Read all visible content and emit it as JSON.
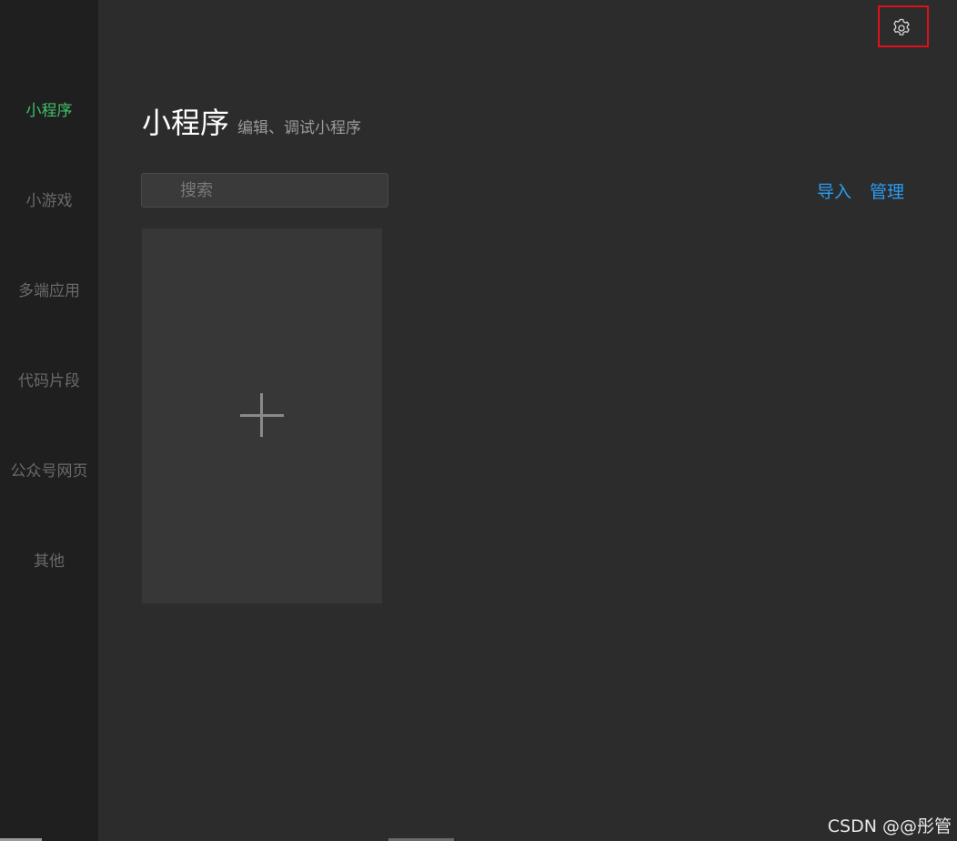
{
  "sidebar": {
    "items": [
      {
        "label": "小程序",
        "active": true
      },
      {
        "label": "小游戏",
        "active": false
      },
      {
        "label": "多端应用",
        "active": false
      },
      {
        "label": "代码片段",
        "active": false
      },
      {
        "label": "公众号网页",
        "active": false
      },
      {
        "label": "其他",
        "active": false
      }
    ]
  },
  "header": {
    "settings_icon": "gear-icon",
    "title": "小程序",
    "subtitle": "编辑、调试小程序"
  },
  "toolbar": {
    "search_placeholder": "搜索",
    "search_value": "",
    "import_label": "导入",
    "manage_label": "管理"
  },
  "projects": {
    "new_icon": "plus-icon"
  },
  "watermark": "CSDN @@彤管",
  "colors": {
    "background": "#2c2c2c",
    "sidebar": "#1f1f1f",
    "active": "#3fc06a",
    "link": "#2a9df4",
    "highlight": "#e0101a"
  }
}
